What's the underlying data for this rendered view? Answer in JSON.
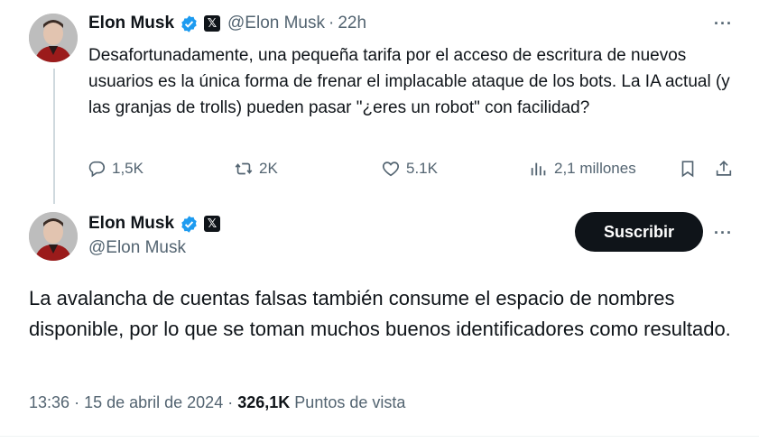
{
  "reply_tweet": {
    "author_name": "Elon Musk",
    "handle": "@Elon Musk",
    "separator": "·",
    "time": "22h",
    "more": "···",
    "text": "Desafortunadamente, una pequeña tarifa por el acceso de escritura de nuevos usuarios es la única forma de frenar el implacable ataque de los bots. La IA actual (y las granjas de trolls) pueden pasar \"¿eres un robot\" con facilidad?",
    "actions": {
      "replies": "1,5K",
      "reposts": "2K",
      "likes": "5.1K",
      "views": "2,1 millones"
    }
  },
  "main_tweet": {
    "author_name": "Elon Musk",
    "handle": "@Elon Musk",
    "subscribe_label": "Suscribir",
    "more": "···",
    "text": "La avalancha de cuentas falsas también consume el espacio de nombres disponible, por lo que se toman muchos buenos identificadores como resultado.",
    "meta": {
      "time": "13:36",
      "separator": "·",
      "date": "15 de abril de 2024",
      "views_count": "326,1K",
      "views_label": "Puntos de vista"
    }
  },
  "badges": {
    "x_logo": "𝕏"
  },
  "colors": {
    "verified": "#1d9bf0",
    "text": "#0f1419",
    "secondary": "#536471"
  }
}
